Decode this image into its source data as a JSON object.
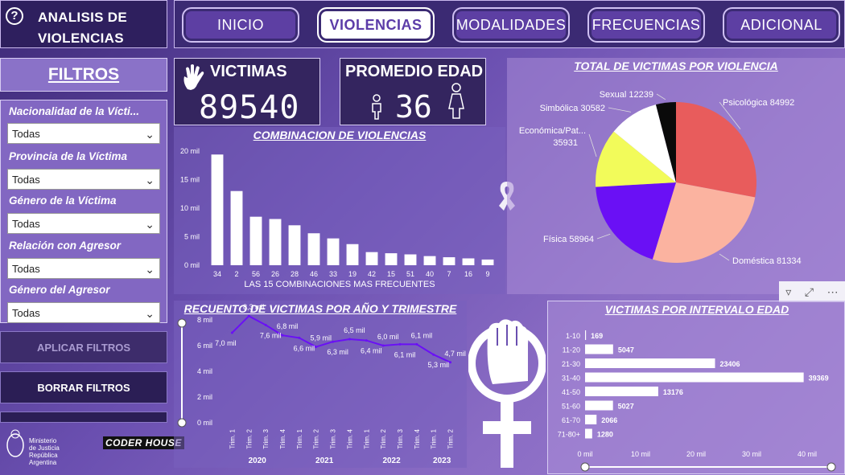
{
  "app": {
    "title": "ANALISIS DE VIOLENCIAS",
    "help_icon": "question-icon"
  },
  "nav": [
    {
      "label": "INICIO",
      "active": false
    },
    {
      "label": "VIOLENCIAS",
      "active": true
    },
    {
      "label": "MODALIDADES",
      "active": false
    },
    {
      "label": "FRECUENCIAS",
      "active": false
    },
    {
      "label": "ADICIONAL",
      "active": false
    }
  ],
  "filters": {
    "title": "FILTROS",
    "items": [
      {
        "label": "Nacionalidad de la Vícti...",
        "value": "Todas"
      },
      {
        "label": "Provincia de la Víctima",
        "value": "Todas"
      },
      {
        "label": "Género de la Víctima",
        "value": "Todas"
      },
      {
        "label": "Relación con Agresor",
        "value": "Todas"
      },
      {
        "label": "Género del Agresor",
        "value": "Todas"
      }
    ],
    "apply": "APLICAR FILTROS",
    "clear": "BORRAR FILTROS"
  },
  "kpi": {
    "victims_label": "VICTIMAS",
    "victims_value": "89540",
    "age_label": "PROMEDIO EDAD",
    "age_value": "36"
  },
  "footer": {
    "ministry_line1": "Ministerio de Justicia",
    "ministry_line2": "República Argentina",
    "coder": "CODER HOUSE"
  },
  "colors": {
    "accent": "#6a4fb0",
    "active_nav": "#ffffff",
    "line": "#6a2be0"
  },
  "chart_data": [
    {
      "type": "bar",
      "title": "COMBINACION DE VIOLENCIAS",
      "xlabel": "LAS 15 COMBINACIONES MAS FRECUENTES",
      "categories": [
        "34",
        "2",
        "56",
        "26",
        "28",
        "46",
        "33",
        "19",
        "42",
        "15",
        "51",
        "40",
        "7",
        "16",
        "9"
      ],
      "values": [
        19400,
        13000,
        8500,
        8100,
        7000,
        5600,
        4700,
        3700,
        2300,
        2100,
        1900,
        1600,
        1400,
        1200,
        1000
      ],
      "yticks": [
        "0 mil",
        "5 mil",
        "10 mil",
        "15 mil",
        "20 mil"
      ],
      "ylim": [
        0,
        20000
      ]
    },
    {
      "type": "pie",
      "title": "TOTAL DE VICTIMAS POR VIOLENCIA",
      "slices": [
        {
          "label": "Psicológica",
          "value": 84992,
          "text": "84992",
          "color": "#e85c5c"
        },
        {
          "label": "Doméstica",
          "value": 81334,
          "text": "81334",
          "color": "#fbb3a0"
        },
        {
          "label": "Física",
          "value": 58964,
          "text": "58964",
          "color": "#6a10f5"
        },
        {
          "label": "Económica/Pat...",
          "value": 35931,
          "text": "35931",
          "color": "#f2fb5a"
        },
        {
          "label": "Simbólica",
          "value": 30582,
          "text": "30582",
          "color": "#ffffff"
        },
        {
          "label": "Sexual",
          "value": 12239,
          "text": "12239",
          "color": "#0a0a0a"
        }
      ]
    },
    {
      "type": "line",
      "title": "RECUENTO DE VICTIMAS POR AÑO Y TRIMESTRE",
      "x": [
        "Trim. 1",
        "Trim. 2",
        "Trim. 3",
        "Trim. 4",
        "Trim. 1",
        "Trim. 2",
        "Trim. 3",
        "Trim. 4",
        "Trim. 1",
        "Trim. 2",
        "Trim. 3",
        "Trim. 4",
        "Trim. 1",
        "Trim. 2"
      ],
      "years": [
        {
          "label": "2020"
        },
        {
          "label": "2021"
        },
        {
          "label": "2022"
        },
        {
          "label": "2023"
        }
      ],
      "values": [
        7.0,
        8.3,
        7.6,
        6.8,
        6.6,
        5.9,
        6.3,
        6.5,
        6.4,
        6.0,
        6.1,
        6.1,
        5.3,
        4.7
      ],
      "labels": [
        "7,0 mil",
        "8,3 mil",
        "7,6 mil",
        "6,8 mil",
        "6,6 mil",
        "5,9 mil",
        "6,3 mil",
        "6,5 mil",
        "6,4 mil",
        "6,0 mil",
        "6,1 mil",
        "6,1 mil",
        "5,3 mil",
        "4,7 mil"
      ],
      "yticks": [
        "0 mil",
        "2 mil",
        "4 mil",
        "6 mil",
        "8 mil"
      ],
      "ylim": [
        0,
        8
      ]
    },
    {
      "type": "bar",
      "title": "VICTIMAS POR INTERVALO EDAD",
      "orientation": "horizontal",
      "categories": [
        "1-10",
        "11-20",
        "21-30",
        "31-40",
        "41-50",
        "51-60",
        "61-70",
        "71-80+"
      ],
      "values": [
        169,
        5047,
        23406,
        39369,
        13176,
        5027,
        2066,
        1280
      ],
      "labels": [
        "169",
        "5047",
        "23406",
        "39369",
        "13176",
        "5027",
        "2066",
        "1280"
      ],
      "xticks": [
        "0 mil",
        "10 mil",
        "20 mil",
        "30 mil",
        "40 mil"
      ],
      "xlim": [
        0,
        40000
      ]
    }
  ]
}
